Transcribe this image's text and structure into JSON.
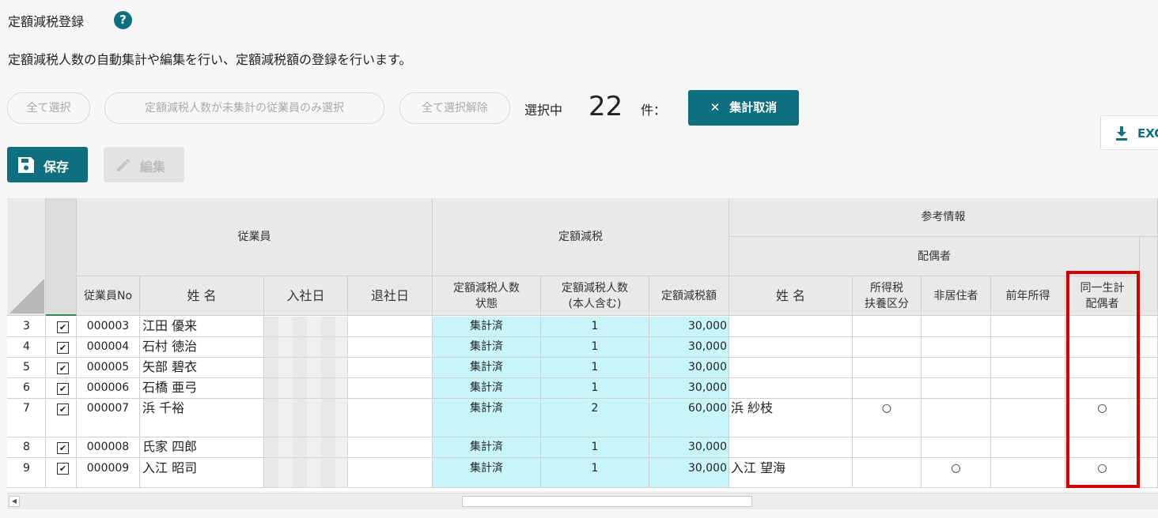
{
  "page": {
    "title": "定額減税登録",
    "help_symbol": "?",
    "description": "定額減税人数の自動集計や編集を行い、定額減税額の登録を行います。"
  },
  "toolbar": {
    "select_all": "全て選択",
    "select_unaggregated": "定額減税人数が未集計の従業員のみ選択",
    "deselect_all": "全て選択解除",
    "selecting_label": "選択中",
    "selected_count": "22",
    "count_unit": "件：",
    "cancel_aggregation": "集計取消",
    "excel_label": "EXC",
    "save_label": "保存",
    "edit_label": "編集"
  },
  "grid": {
    "groups": {
      "employee": "従業員",
      "tax_reduction": "定額減税",
      "reference": "参考情報",
      "spouse": "配偶者"
    },
    "columns": {
      "emp_no": "従業員No",
      "name": "姓 名",
      "hire_date": "入社日",
      "leave_date": "退社日",
      "status_1": "定額減税人数",
      "status_2": "状態",
      "count_1": "定額減税人数",
      "count_2": "(本人含む)",
      "amount": "定額減税額",
      "spouse_name": "姓 名",
      "dependent_1": "所得税",
      "dependent_2": "扶養区分",
      "nonresident": "非居住者",
      "prev_income": "前年所得",
      "same_household_1": "同一生計",
      "same_household_2": "配偶者"
    },
    "rows": [
      {
        "row": "3",
        "checked": "✔",
        "no": "000003",
        "name": "江田 優来",
        "status": "集計済",
        "count": "1",
        "amount": "30,000",
        "spouse_name": "",
        "dependent": "",
        "nonresident": "",
        "same_household": ""
      },
      {
        "row": "4",
        "checked": "✔",
        "no": "000004",
        "name": "石村 徳治",
        "status": "集計済",
        "count": "1",
        "amount": "30,000",
        "spouse_name": "",
        "dependent": "",
        "nonresident": "",
        "same_household": ""
      },
      {
        "row": "5",
        "checked": "✔",
        "no": "000005",
        "name": "矢部 碧衣",
        "status": "集計済",
        "count": "1",
        "amount": "30,000",
        "spouse_name": "",
        "dependent": "",
        "nonresident": "",
        "same_household": ""
      },
      {
        "row": "6",
        "checked": "✔",
        "no": "000006",
        "name": "石橋 亜弓",
        "status": "集計済",
        "count": "1",
        "amount": "30,000",
        "spouse_name": "",
        "dependent": "",
        "nonresident": "",
        "same_household": ""
      },
      {
        "row": "7",
        "checked": "✔",
        "no": "000007",
        "name": "浜 千裕",
        "status": "集計済",
        "count": "2",
        "amount": "60,000",
        "spouse_name": "浜 紗枝",
        "dependent": "○",
        "nonresident": "",
        "same_household": "○"
      },
      {
        "row": "8",
        "checked": "✔",
        "no": "000008",
        "name": "氏家 四郎",
        "status": "集計済",
        "count": "1",
        "amount": "30,000",
        "spouse_name": "",
        "dependent": "",
        "nonresident": "",
        "same_household": ""
      },
      {
        "row": "9",
        "checked": "✔",
        "no": "000009",
        "name": "入江 昭司",
        "status": "集計済",
        "count": "1",
        "amount": "30,000",
        "spouse_name": "入江 望海",
        "dependent": "",
        "nonresident": "○",
        "same_household": "○"
      }
    ]
  },
  "colors": {
    "primary": "#0e6f7e",
    "aggregated_bg": "#c8f5fa",
    "highlight": "#d40000"
  }
}
